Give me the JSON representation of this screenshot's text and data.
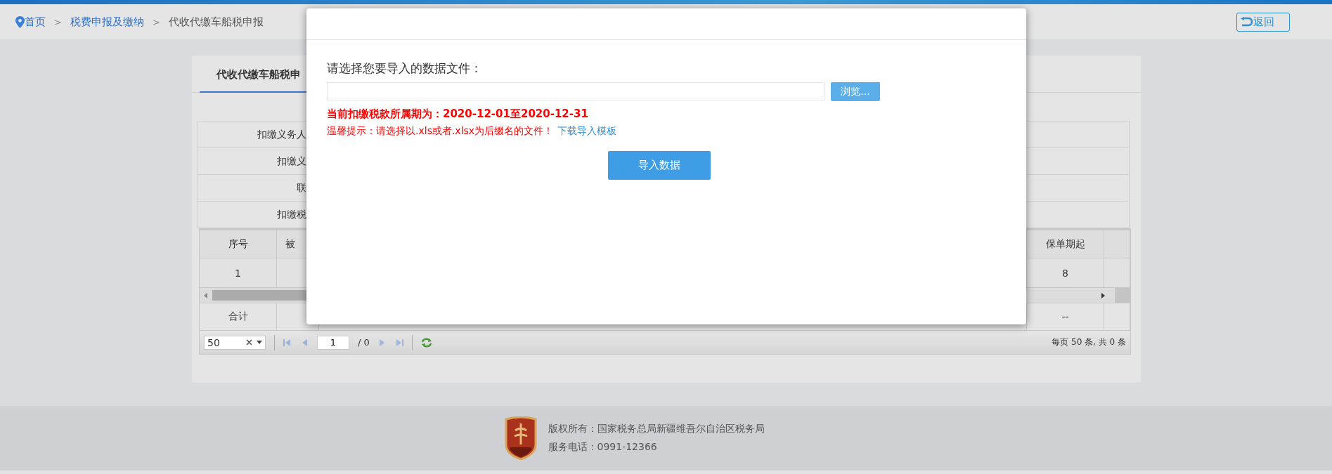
{
  "breadcrumb": [
    {
      "label": "首页",
      "current": false,
      "separator": ">"
    },
    {
      "label": "税费申报及缴纳",
      "current": false,
      "separator": ">"
    },
    {
      "label": "代收代缴车船税申报",
      "current": true
    }
  ],
  "back_button": {
    "label": "返回"
  },
  "tab": {
    "label": "代收代缴车船税申",
    "selected": true
  },
  "form_rows": [
    {
      "label": "扣缴义务人"
    },
    {
      "label": "扣缴义"
    },
    {
      "label": "联"
    },
    {
      "label": "扣缴税"
    }
  ],
  "grid": {
    "columns": [
      "序号",
      "被",
      "保单期起"
    ],
    "rows": [
      {
        "seq": "1",
        "policy_start": "8"
      }
    ],
    "total": {
      "label": "合计",
      "value": "--"
    }
  },
  "pager": {
    "page_size": "50",
    "page": "1",
    "total_pages": "/ 0",
    "summary": "每页 50 条, 共 0 条"
  },
  "dialog": {
    "prompt": "请选择您要导入的数据文件：",
    "browse_button": "浏览...",
    "period": "当前扣缴税款所属期为：2020-12-01至2020-12-31",
    "tip": "温馨提示：请选择以.xls或者.xlsx为后缀名的文件！",
    "template_link": "下载导入模板",
    "import_button": "导入数据"
  },
  "footer": {
    "copyright": "版权所有：国家税务总局新疆维吾尔自治区税务局",
    "phone": "服务电话：0991-12366"
  }
}
